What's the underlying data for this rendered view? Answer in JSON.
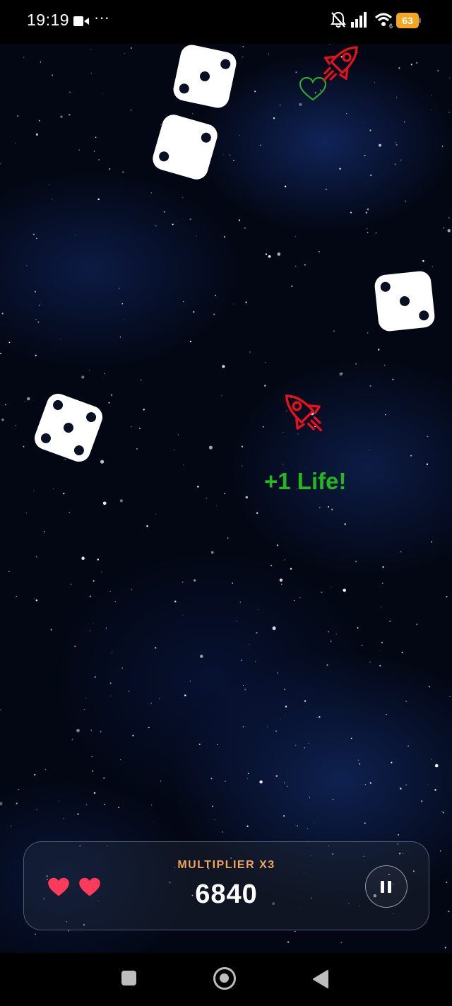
{
  "status_bar": {
    "time": "19:19",
    "battery_level": "63",
    "icons": [
      "video-camera-icon",
      "more-dots-icon",
      "notifications-muted-icon",
      "signal-icon",
      "wifi-icon",
      "battery-icon"
    ],
    "battery_color": "#f5a623"
  },
  "game": {
    "dice": [
      {
        "face": 3,
        "label": "die-three"
      },
      {
        "face": 2,
        "label": "die-two"
      },
      {
        "face": 3,
        "label": "die-three"
      },
      {
        "face": 5,
        "label": "die-five"
      }
    ],
    "enemies": [
      "rocket-icon",
      "rocket-icon"
    ],
    "pickups": [
      "heart-outline-icon"
    ],
    "floating_text": "+1 Life!",
    "floating_text_color": "#22b81e",
    "rocket_color": "#e8101a"
  },
  "hud": {
    "lives": 2,
    "multiplier_label": "MULTIPLIER X3",
    "score": "6840",
    "pause_icon": "pause-icon",
    "accent_color": "#f2a45a"
  },
  "nav_bar": {
    "buttons": [
      "recents-button",
      "home-button",
      "back-button"
    ]
  }
}
